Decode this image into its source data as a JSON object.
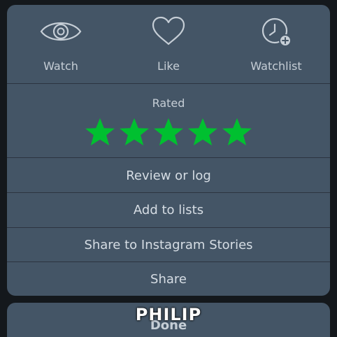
{
  "actions": [
    {
      "label": "Watch",
      "icon": "eye-icon"
    },
    {
      "label": "Like",
      "icon": "heart-icon"
    },
    {
      "label": "Watchlist",
      "icon": "watchlist-clock-plus-icon"
    }
  ],
  "rating": {
    "label": "Rated",
    "stars": 5,
    "max_stars": 5,
    "star_color": "#00c030"
  },
  "menu": {
    "review_or_log": "Review or log",
    "add_to_lists": "Add to lists",
    "share_instagram": "Share to Instagram Stories",
    "share": "Share"
  },
  "done": {
    "label": "Done"
  },
  "caption": "PHILIP",
  "colors": {
    "sheet_bg": "#445566",
    "page_bg": "#14181c",
    "text": "#c6ced6",
    "accent_star": "#00c030"
  }
}
